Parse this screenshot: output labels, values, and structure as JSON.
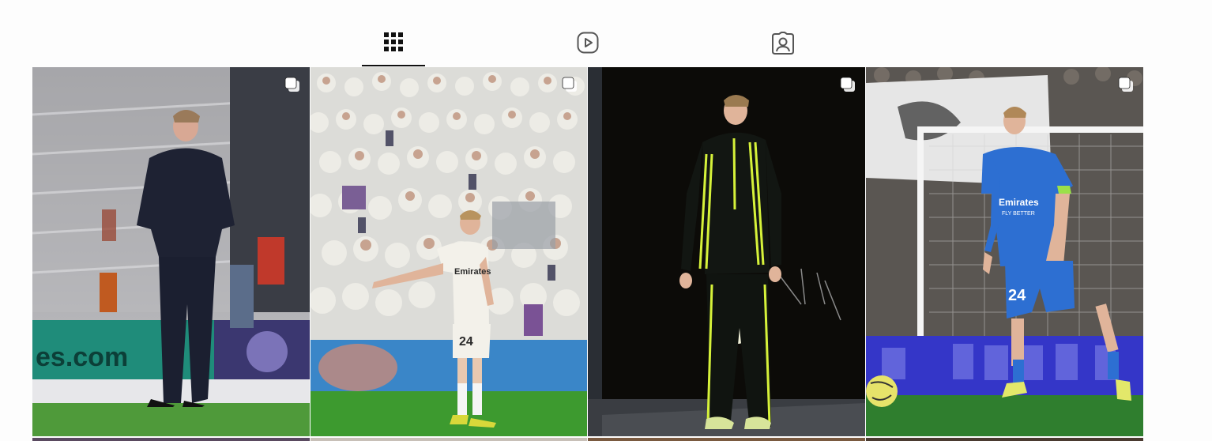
{
  "tabs": [
    {
      "id": "posts",
      "icon": "grid-icon",
      "active": true
    },
    {
      "id": "reels",
      "icon": "reels-play-icon",
      "active": false
    },
    {
      "id": "tagged",
      "icon": "tagged-person-icon",
      "active": false
    }
  ],
  "posts": [
    {
      "scene": "player in navy suit standing on pitch",
      "multi": true,
      "sign_text": "es.com"
    },
    {
      "scene": "player in white kit pointing in front of crowd",
      "multi": true,
      "shirt_text": "Emirates",
      "number": "24"
    },
    {
      "scene": "player in black tracksuit holding boots",
      "multi": true
    },
    {
      "scene": "player in blue kit with ball",
      "multi": true,
      "shirt_text": "Emirates",
      "shirt_sub": "FLY BETTER",
      "number": "24"
    }
  ],
  "colors": {
    "active_border": "#111111",
    "icon": "#555555",
    "overlay_icon": "#ffffff"
  }
}
